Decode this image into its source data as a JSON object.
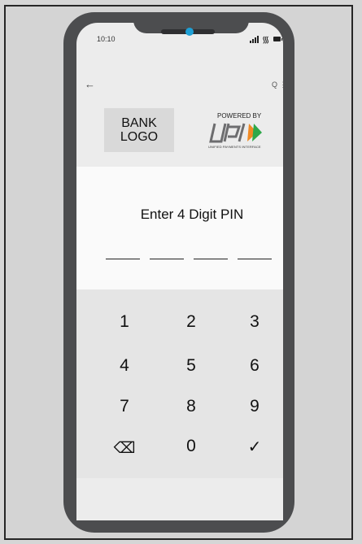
{
  "status": {
    "time": "10:10"
  },
  "header": {
    "bank_logo": [
      "BANK",
      "LOGO"
    ],
    "upi_powered": "POWERED BY",
    "upi_subtitle": "UNIFIED PAYMENTS INTERFACE"
  },
  "pin": {
    "title": "Enter 4 Digit PIN"
  },
  "keypad": {
    "keys": [
      "1",
      "2",
      "3",
      "4",
      "5",
      "6",
      "7",
      "8",
      "9",
      "⌫",
      "0",
      "✓"
    ]
  },
  "colors": {
    "upi_green": "#2ea84a",
    "upi_orange": "#f08a24",
    "upi_gray": "#6d6d6f"
  }
}
